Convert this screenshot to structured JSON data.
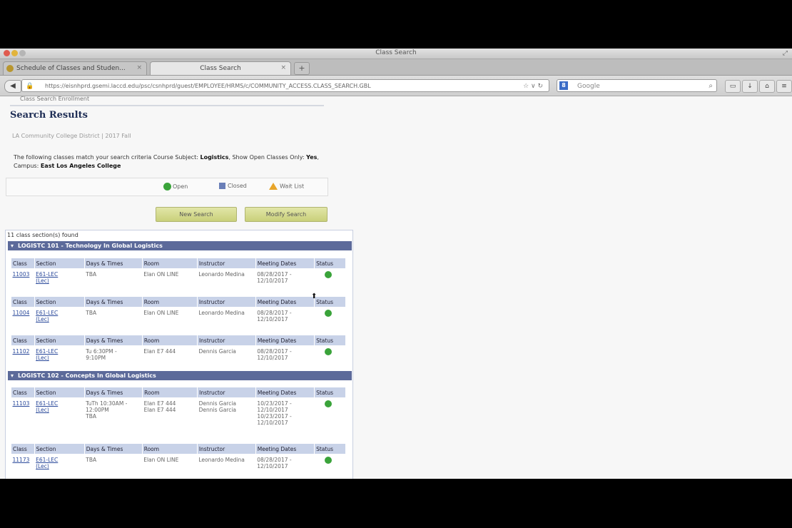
{
  "window": {
    "title": "Class Search"
  },
  "tabs": [
    {
      "label": "Schedule of Classes and Studen..."
    },
    {
      "label": "Class Search"
    }
  ],
  "toolbar": {
    "url": "https://eisnhprd.gsemi.laccd.edu/psc/csnhprd/guest/EMPLOYEE/HRMS/c/COMMUNITY_ACCESS.CLASS_SEARCH.GBL",
    "search_placeholder": "Google",
    "back_glyph": "◀",
    "new_tab_glyph": "+",
    "g_glyph": "8"
  },
  "page": {
    "breadcrumb": "Class Search  Enrollment",
    "heading": "Search Results",
    "college": "LA Community College District | 2017 Fall",
    "criteria_lead": "The following classes match your search criteria Course Subject:",
    "criteria_subject": "Logistics",
    "criteria_mid": ",  Show Open Classes Only:",
    "criteria_open": "Yes",
    "criteria_campus_label": ",  Campus:",
    "criteria_campus": "East Los Angeles College",
    "legend": {
      "open": "Open",
      "closed": "Closed",
      "waitlist": "Wait List"
    },
    "buttons": {
      "new_search": "New Search",
      "modify_search": "Modify Search"
    },
    "count_text": "11 class section(s) found"
  },
  "headers": [
    "Class",
    "Section",
    "Days & Times",
    "Room",
    "Instructor",
    "Meeting Dates",
    "Status"
  ],
  "courses": [
    {
      "title": "LOGISTC 101 - Technology In Global Logistics",
      "sections": [
        {
          "class": "11003",
          "section": "E61-LEC",
          "section2": "(Lec)",
          "days": "TBA",
          "room": "Elan ON LINE",
          "instructor": "Leonardo Medina",
          "dates": "08/28/2017 -",
          "dates2": "12/10/2017"
        },
        {
          "class": "11004",
          "section": "E61-LEC",
          "section2": "(Lec)",
          "days": "TBA",
          "room": "Elan ON LINE",
          "instructor": "Leonardo Medina",
          "dates": "08/28/2017 -",
          "dates2": "12/10/2017"
        },
        {
          "class": "11102",
          "section": "E61-LEC",
          "section2": "(Lec)",
          "days": "Tu 6:30PM -",
          "days2": "9:10PM",
          "room": "Elan E7 444",
          "instructor": "Dennis Garcia",
          "dates": "08/28/2017 -",
          "dates2": "12/10/2017"
        }
      ]
    },
    {
      "title": "LOGISTC 102 - Concepts In Global Logistics",
      "sections": [
        {
          "class": "11103",
          "section": "E61-LEC",
          "section2": "(Lec)",
          "days": "TuTh 10:30AM -",
          "days2": "12:00PM",
          "days3": "TBA",
          "room": "Elan E7 444",
          "room2": "Elan E7 444",
          "instructor": "Dennis Garcia",
          "instructor2": "Dennis Garcia",
          "dates": "10/23/2017 -",
          "dates2": "12/10/2017",
          "dates3": "10/23/2017 -",
          "dates4": "12/10/2017"
        },
        {
          "class": "11173",
          "section": "E61-LEC",
          "section2": "(Lec)",
          "days": "TBA",
          "room": "Elan ON LINE",
          "instructor": "Leonardo Medina",
          "dates": "08/28/2017 -",
          "dates2": "12/10/2017"
        }
      ]
    }
  ],
  "colors": {
    "course_bar": "#5c6a9a",
    "header_cell": "#c8d2e8",
    "open_status": "#3aa33a",
    "button": "#d6dc8e"
  },
  "icons": {
    "open": "green-circle-icon",
    "closed": "blue-square-icon",
    "waitlist": "yellow-triangle-icon"
  }
}
